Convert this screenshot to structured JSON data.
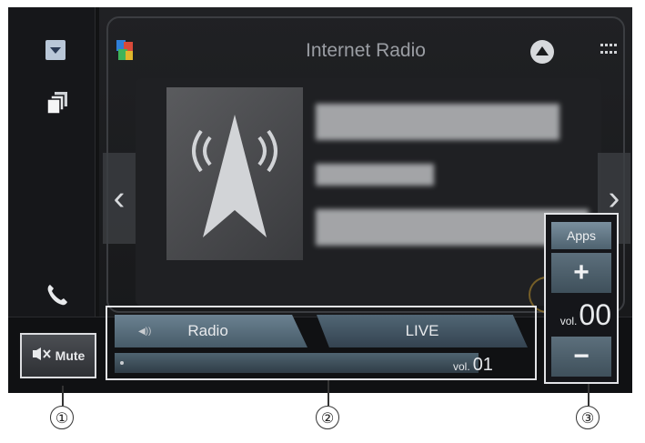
{
  "header": {
    "title": "Internet Radio"
  },
  "mute": {
    "label": "Mute"
  },
  "source_bar": {
    "radio_label": "Radio",
    "live_label": "LIVE",
    "vol_prefix": "vol.",
    "vol_value": "01"
  },
  "volume_panel": {
    "apps_label": "Apps",
    "plus_label": "+",
    "vol_prefix": "vol.",
    "vol_value": "00",
    "minus_label": "−"
  },
  "callouts": [
    "①",
    "②",
    "③"
  ],
  "colors": {
    "background": "#121314",
    "tab_accent": "#6b8191",
    "frame": "#e2e3e6"
  }
}
